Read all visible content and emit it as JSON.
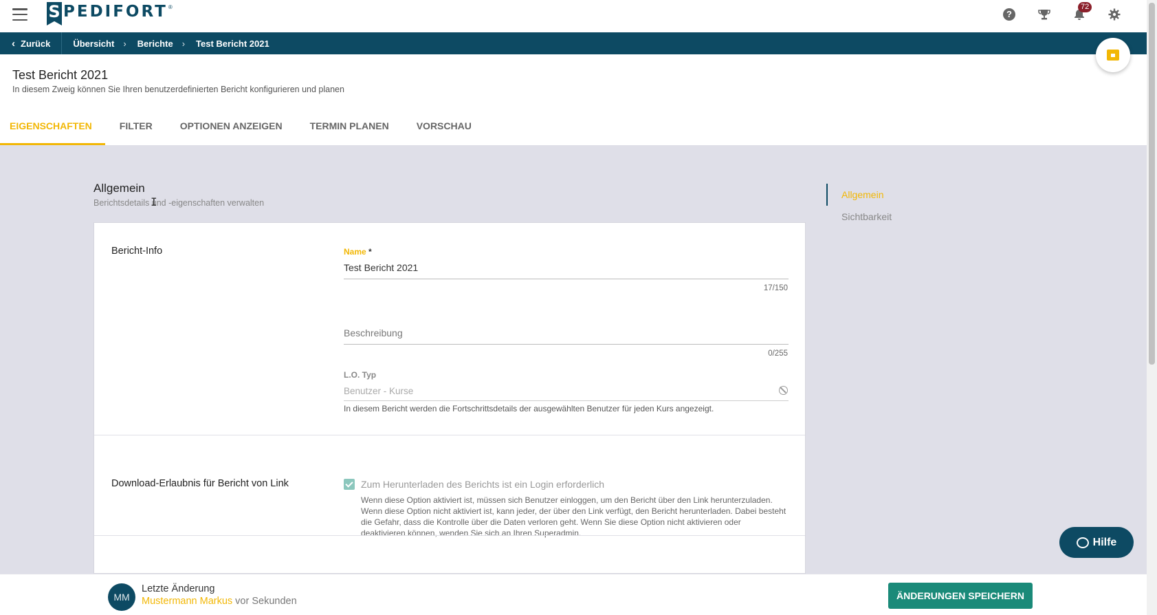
{
  "topbar": {
    "logo_letter": "S",
    "logo_text": "PEDIFORT",
    "logo_reg": "®",
    "help_glyph": "?",
    "notification_count": "72",
    "icons": [
      "menu-icon",
      "help-icon",
      "trophy-icon",
      "bell-icon",
      "gear-icon"
    ]
  },
  "breadcrumb": {
    "back_label": "Zurück",
    "items": [
      "Übersicht",
      "Berichte",
      "Test Bericht 2021"
    ],
    "separator": "›"
  },
  "header": {
    "title": "Test Bericht 2021",
    "subtitle": "In diesem Zweig können Sie Ihren benutzerdefinierten Bericht konfigurieren und planen",
    "tabs": [
      {
        "label": "EIGENSCHAFTEN",
        "active": true
      },
      {
        "label": "FILTER",
        "active": false
      },
      {
        "label": "OPTIONEN ANZEIGEN",
        "active": false
      },
      {
        "label": "TERMIN PLANEN",
        "active": false
      },
      {
        "label": "VORSCHAU",
        "active": false
      }
    ]
  },
  "section": {
    "title": "Allgemein",
    "subtitle": "Berichtsdetails und -eigenschaften verwalten"
  },
  "card": {
    "bericht_info_label": "Bericht-Info",
    "name": {
      "label": "Name",
      "required_mark": " *",
      "value": "Test Bericht 2021",
      "counter": "17/150"
    },
    "description": {
      "placeholder": "Beschreibung",
      "counter": "0/255"
    },
    "lo_type": {
      "label": "L.O. Typ",
      "value": "Benutzer - Kurse",
      "hint": "In diesem Bericht werden die Fortschrittsdetails der ausgewählten Benutzer für jeden Kurs angezeigt."
    },
    "download": {
      "label": "Download-Erlaubnis für Bericht von Link",
      "checkbox_label": "Zum Herunterladen des Berichts ist ein Login erforderlich",
      "checked": true,
      "description": "Wenn diese Option aktiviert ist, müssen sich Benutzer einloggen, um den Bericht über den Link herunterzuladen. Wenn diese Option nicht aktiviert ist, kann jeder, der über den Link verfügt, den Bericht herunterladen. Dabei besteht die Gefahr, dass die Kontrolle über die Daten verloren geht. Wenn Sie diese Option nicht aktivieren oder deaktivieren können, wenden Sie sich an Ihren Superadmin."
    }
  },
  "side_nav": {
    "items": [
      {
        "label": "Allgemein",
        "active": true
      },
      {
        "label": "Sichtbarkeit",
        "active": false
      }
    ]
  },
  "help_button": {
    "label": "Hilfe"
  },
  "footer": {
    "avatar_initials": "MM",
    "title": "Letzte Änderung",
    "user": "Mustermann Markus",
    "time": " vor Sekunden",
    "save_label": "ÄNDERUNGEN SPEICHERN"
  },
  "colors": {
    "brand": "#0d4a63",
    "accent": "#f2b705",
    "save": "#1a8a79",
    "badge": "#8b1f2a"
  }
}
